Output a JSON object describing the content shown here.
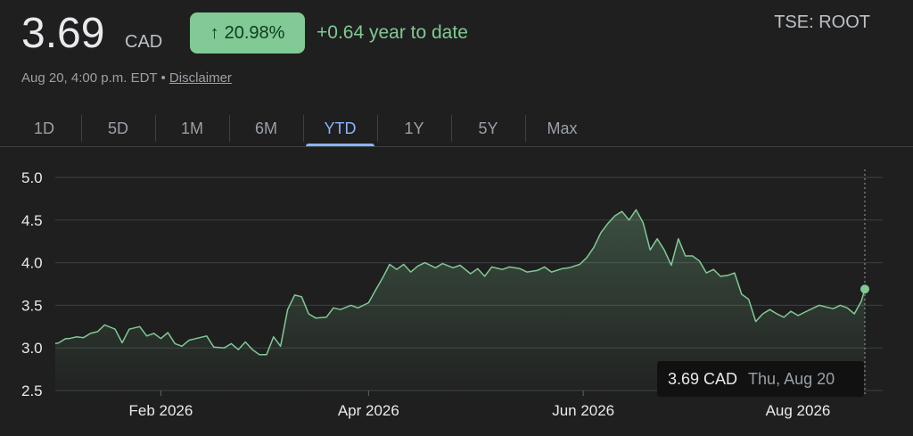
{
  "header": {
    "price": "3.69",
    "currency": "CAD",
    "change_arrow": "↑",
    "change_percent": "20.98%",
    "change_text": "+0.64 year to date",
    "ticker": "TSE: ROOT",
    "timestamp": "Aug 20, 4:00 p.m. EDT",
    "separator": "•",
    "disclaimer": "Disclaimer"
  },
  "colors": {
    "background": "#1f1f1f",
    "positive": "#81c995",
    "accent_active_tab": "#8ab4f8",
    "line": "#81c995"
  },
  "tabs": [
    {
      "label": "1D",
      "active": false
    },
    {
      "label": "5D",
      "active": false
    },
    {
      "label": "1M",
      "active": false
    },
    {
      "label": "6M",
      "active": false
    },
    {
      "label": "YTD",
      "active": true
    },
    {
      "label": "1Y",
      "active": false
    },
    {
      "label": "5Y",
      "active": false
    },
    {
      "label": "Max",
      "active": false
    }
  ],
  "tooltip": {
    "value": "3.69 CAD",
    "date": "Thu, Aug 20"
  },
  "chart_data": {
    "type": "area",
    "title": "",
    "xlabel": "",
    "ylabel": "",
    "ylim": [
      2.5,
      5.0
    ],
    "y_ticks": [
      "5.0",
      "4.5",
      "4.0",
      "3.5",
      "3.0",
      "2.5"
    ],
    "x_ticks": [
      {
        "label": "Feb 2026",
        "date": "2026-02-01"
      },
      {
        "label": "Apr 2026",
        "date": "2026-04-01"
      },
      {
        "label": "Jun 2026",
        "date": "2026-06-01"
      },
      {
        "label": "Aug 2026",
        "date": "2026-08-01"
      }
    ],
    "x_range": [
      "2026-01-02",
      "2026-08-20"
    ],
    "grid": true,
    "series": [
      {
        "points": [
          [
            "2026-01-02",
            3.05
          ],
          [
            "2026-01-03",
            3.06
          ],
          [
            "2026-01-05",
            3.11
          ],
          [
            "2026-01-06",
            3.11
          ],
          [
            "2026-01-08",
            3.13
          ],
          [
            "2026-01-10",
            3.12
          ],
          [
            "2026-01-12",
            3.17
          ],
          [
            "2026-01-14",
            3.19
          ],
          [
            "2026-01-16",
            3.27
          ],
          [
            "2026-01-19",
            3.22
          ],
          [
            "2026-01-21",
            3.06
          ],
          [
            "2026-01-23",
            3.22
          ],
          [
            "2026-01-26",
            3.25
          ],
          [
            "2026-01-28",
            3.14
          ],
          [
            "2026-01-30",
            3.17
          ],
          [
            "2026-02-01",
            3.11
          ],
          [
            "2026-02-03",
            3.18
          ],
          [
            "2026-02-05",
            3.05
          ],
          [
            "2026-02-07",
            3.02
          ],
          [
            "2026-02-09",
            3.09
          ],
          [
            "2026-02-12",
            3.12
          ],
          [
            "2026-02-14",
            3.14
          ],
          [
            "2026-02-16",
            3.01
          ],
          [
            "2026-02-19",
            3.0
          ],
          [
            "2026-02-21",
            3.05
          ],
          [
            "2026-02-23",
            2.98
          ],
          [
            "2026-02-25",
            3.07
          ],
          [
            "2026-02-27",
            2.98
          ],
          [
            "2026-03-01",
            2.92
          ],
          [
            "2026-03-03",
            2.92
          ],
          [
            "2026-03-05",
            3.13
          ],
          [
            "2026-03-07",
            3.02
          ],
          [
            "2026-03-09",
            3.45
          ],
          [
            "2026-03-11",
            3.62
          ],
          [
            "2026-03-13",
            3.6
          ],
          [
            "2026-03-15",
            3.4
          ],
          [
            "2026-03-17",
            3.35
          ],
          [
            "2026-03-20",
            3.36
          ],
          [
            "2026-03-22",
            3.47
          ],
          [
            "2026-03-24",
            3.45
          ],
          [
            "2026-03-27",
            3.5
          ],
          [
            "2026-03-29",
            3.47
          ],
          [
            "2026-04-01",
            3.53
          ],
          [
            "2026-04-03",
            3.68
          ],
          [
            "2026-04-05",
            3.82
          ],
          [
            "2026-04-07",
            3.98
          ],
          [
            "2026-04-09",
            3.92
          ],
          [
            "2026-04-11",
            3.98
          ],
          [
            "2026-04-13",
            3.89
          ],
          [
            "2026-04-15",
            3.96
          ],
          [
            "2026-04-17",
            4.0
          ],
          [
            "2026-04-20",
            3.94
          ],
          [
            "2026-04-22",
            3.99
          ],
          [
            "2026-04-25",
            3.94
          ],
          [
            "2026-04-27",
            3.97
          ],
          [
            "2026-04-30",
            3.87
          ],
          [
            "2026-05-02",
            3.93
          ],
          [
            "2026-05-04",
            3.84
          ],
          [
            "2026-05-06",
            3.95
          ],
          [
            "2026-05-09",
            3.92
          ],
          [
            "2026-05-11",
            3.95
          ],
          [
            "2026-05-14",
            3.93
          ],
          [
            "2026-05-16",
            3.89
          ],
          [
            "2026-05-19",
            3.91
          ],
          [
            "2026-05-21",
            3.95
          ],
          [
            "2026-05-23",
            3.89
          ],
          [
            "2026-05-26",
            3.93
          ],
          [
            "2026-05-28",
            3.94
          ],
          [
            "2026-05-31",
            3.98
          ],
          [
            "2026-06-02",
            4.06
          ],
          [
            "2026-06-04",
            4.18
          ],
          [
            "2026-06-06",
            4.35
          ],
          [
            "2026-06-08",
            4.46
          ],
          [
            "2026-06-10",
            4.55
          ],
          [
            "2026-06-12",
            4.6
          ],
          [
            "2026-06-14",
            4.5
          ],
          [
            "2026-06-16",
            4.62
          ],
          [
            "2026-06-18",
            4.47
          ],
          [
            "2026-06-20",
            4.15
          ],
          [
            "2026-06-22",
            4.28
          ],
          [
            "2026-06-24",
            4.15
          ],
          [
            "2026-06-26",
            3.97
          ],
          [
            "2026-06-28",
            4.28
          ],
          [
            "2026-06-30",
            4.08
          ],
          [
            "2026-07-02",
            4.08
          ],
          [
            "2026-07-04",
            4.02
          ],
          [
            "2026-07-06",
            3.88
          ],
          [
            "2026-07-08",
            3.92
          ],
          [
            "2026-07-10",
            3.84
          ],
          [
            "2026-07-12",
            3.85
          ],
          [
            "2026-07-14",
            3.88
          ],
          [
            "2026-07-16",
            3.63
          ],
          [
            "2026-07-18",
            3.57
          ],
          [
            "2026-07-20",
            3.31
          ],
          [
            "2026-07-22",
            3.4
          ],
          [
            "2026-07-24",
            3.45
          ],
          [
            "2026-07-26",
            3.4
          ],
          [
            "2026-07-28",
            3.36
          ],
          [
            "2026-07-30",
            3.43
          ],
          [
            "2026-08-01",
            3.38
          ],
          [
            "2026-08-03",
            3.42
          ],
          [
            "2026-08-05",
            3.46
          ],
          [
            "2026-08-07",
            3.5
          ],
          [
            "2026-08-09",
            3.48
          ],
          [
            "2026-08-11",
            3.46
          ],
          [
            "2026-08-13",
            3.5
          ],
          [
            "2026-08-15",
            3.47
          ],
          [
            "2026-08-17",
            3.4
          ],
          [
            "2026-08-19",
            3.55
          ],
          [
            "2026-08-20",
            3.69
          ]
        ]
      }
    ]
  }
}
